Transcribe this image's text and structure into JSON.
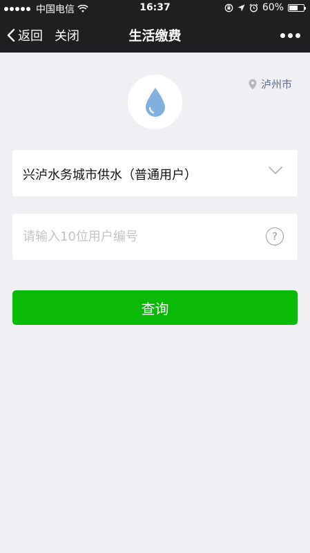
{
  "status_bar": {
    "carrier": "中国电信",
    "time": "16:37",
    "battery": "60%",
    "battery_level": 0.6
  },
  "nav": {
    "back_label": "返回",
    "close_label": "关闭",
    "title": "生活缴费"
  },
  "location": {
    "city": "泸州市"
  },
  "company_select": {
    "selected": "兴泸水务城市供水（普通用户）"
  },
  "account_input": {
    "value": "",
    "placeholder": "请输入10位用户编号"
  },
  "help": {
    "symbol": "?"
  },
  "query_button": {
    "label": "查询"
  },
  "colors": {
    "nav_bg": "#1f1f21",
    "page_bg": "#efeff4",
    "primary_button": "#09bb07",
    "location_text": "#5a6b8c",
    "water_drop": "#7fb0e0"
  }
}
